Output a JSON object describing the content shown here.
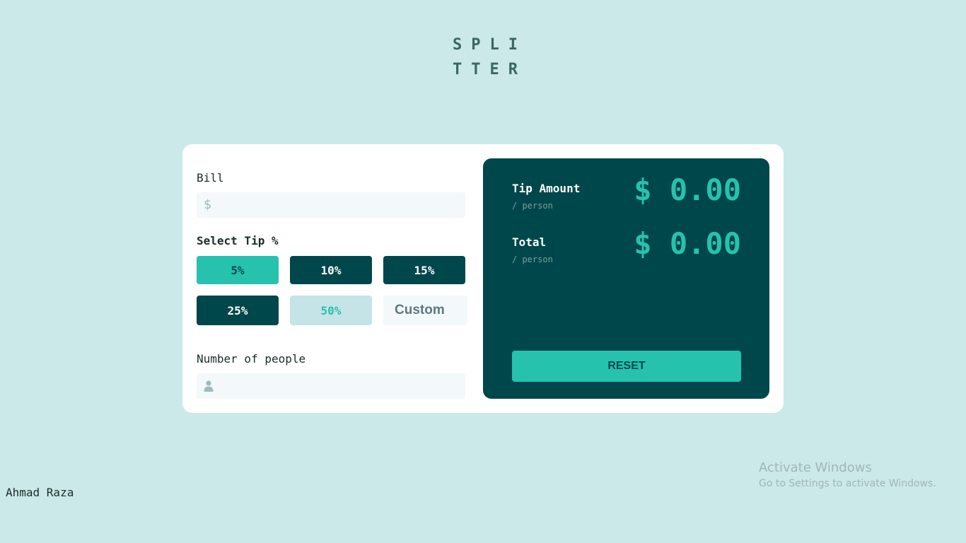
{
  "logo": {
    "line1": "SPLI",
    "line2": "TTER"
  },
  "bill": {
    "label": "Bill",
    "icon": "dollar-icon",
    "icon_glyph": "$",
    "value": ""
  },
  "tip": {
    "label": "Select Tip %",
    "options": [
      {
        "label": "5%",
        "state": "active"
      },
      {
        "label": "10%",
        "state": "default"
      },
      {
        "label": "15%",
        "state": "default"
      },
      {
        "label": "25%",
        "state": "default"
      },
      {
        "label": "50%",
        "state": "light"
      }
    ],
    "custom_placeholder": "Custom"
  },
  "people": {
    "label": "Number of people",
    "icon": "person-icon",
    "value": ""
  },
  "results": {
    "tip_amount": {
      "title": "Tip Amount",
      "sub": "/ person",
      "value": "$ 0.00"
    },
    "total": {
      "title": "Total",
      "sub": "/ person",
      "value": "$ 0.00"
    },
    "reset_label": "RESET"
  },
  "footer": {
    "author": "Ahmad Raza"
  },
  "watermark": {
    "line1": "Activate Windows",
    "line2": "Go to Settings to activate Windows."
  },
  "colors": {
    "background": "#cbe9e8",
    "dark_teal": "#00474b",
    "accent": "#26c2ad",
    "input_bg": "#f3f8fb"
  }
}
